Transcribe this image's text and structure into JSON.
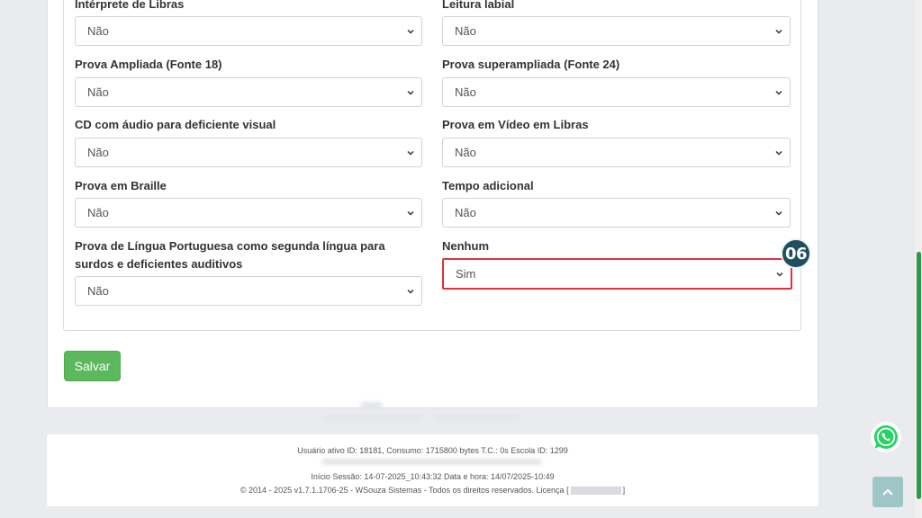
{
  "fields": [
    {
      "label": "Intérprete de Libras",
      "value": "Não"
    },
    {
      "label": "Leitura labial",
      "value": "Não"
    },
    {
      "label": "Prova Ampliada (Fonte 18)",
      "value": "Não"
    },
    {
      "label": "Prova superampliada (Fonte 24)",
      "value": "Não"
    },
    {
      "label": "CD com áudio para deficiente visual",
      "value": "Não"
    },
    {
      "label": "Prova em Vídeo em Libras",
      "value": "Não"
    },
    {
      "label": "Prova em Braille",
      "value": "Não"
    },
    {
      "label": "Tempo adicional",
      "value": "Não"
    },
    {
      "label": "Prova de Língua Portuguesa como segunda língua para surdos e deficientes auditivos",
      "value": "Não"
    },
    {
      "label": "Nenhum",
      "value": "Sim"
    }
  ],
  "step_badge": "06",
  "save_label": "Salvar",
  "footer": {
    "line1": "Usuário ativo ID: 18181, Consumo: 1715800 bytes T.C.: 0s Escola ID: 1299",
    "line2": "Início Sessão: 14-07-2025_10:43:32 Data e hora: 14/07/2025-10:49",
    "line3_prefix": "© 2014 - 2025 v1.7.1.1706-25 - WSouza Sistemas - Todos os direitos reservados. Licença [",
    "line3_suffix": "]"
  },
  "icons": {
    "select_arrow": "chevron-down-icon",
    "whatsapp": "whatsapp-icon",
    "back_to_top": "chevron-up-icon"
  },
  "colors": {
    "save_button": "#5cb85c",
    "highlight_border": "#e0313d",
    "badge": "#1f4e5f",
    "whatsapp": "#25d366",
    "back_to_top": "#9fc6c6"
  }
}
